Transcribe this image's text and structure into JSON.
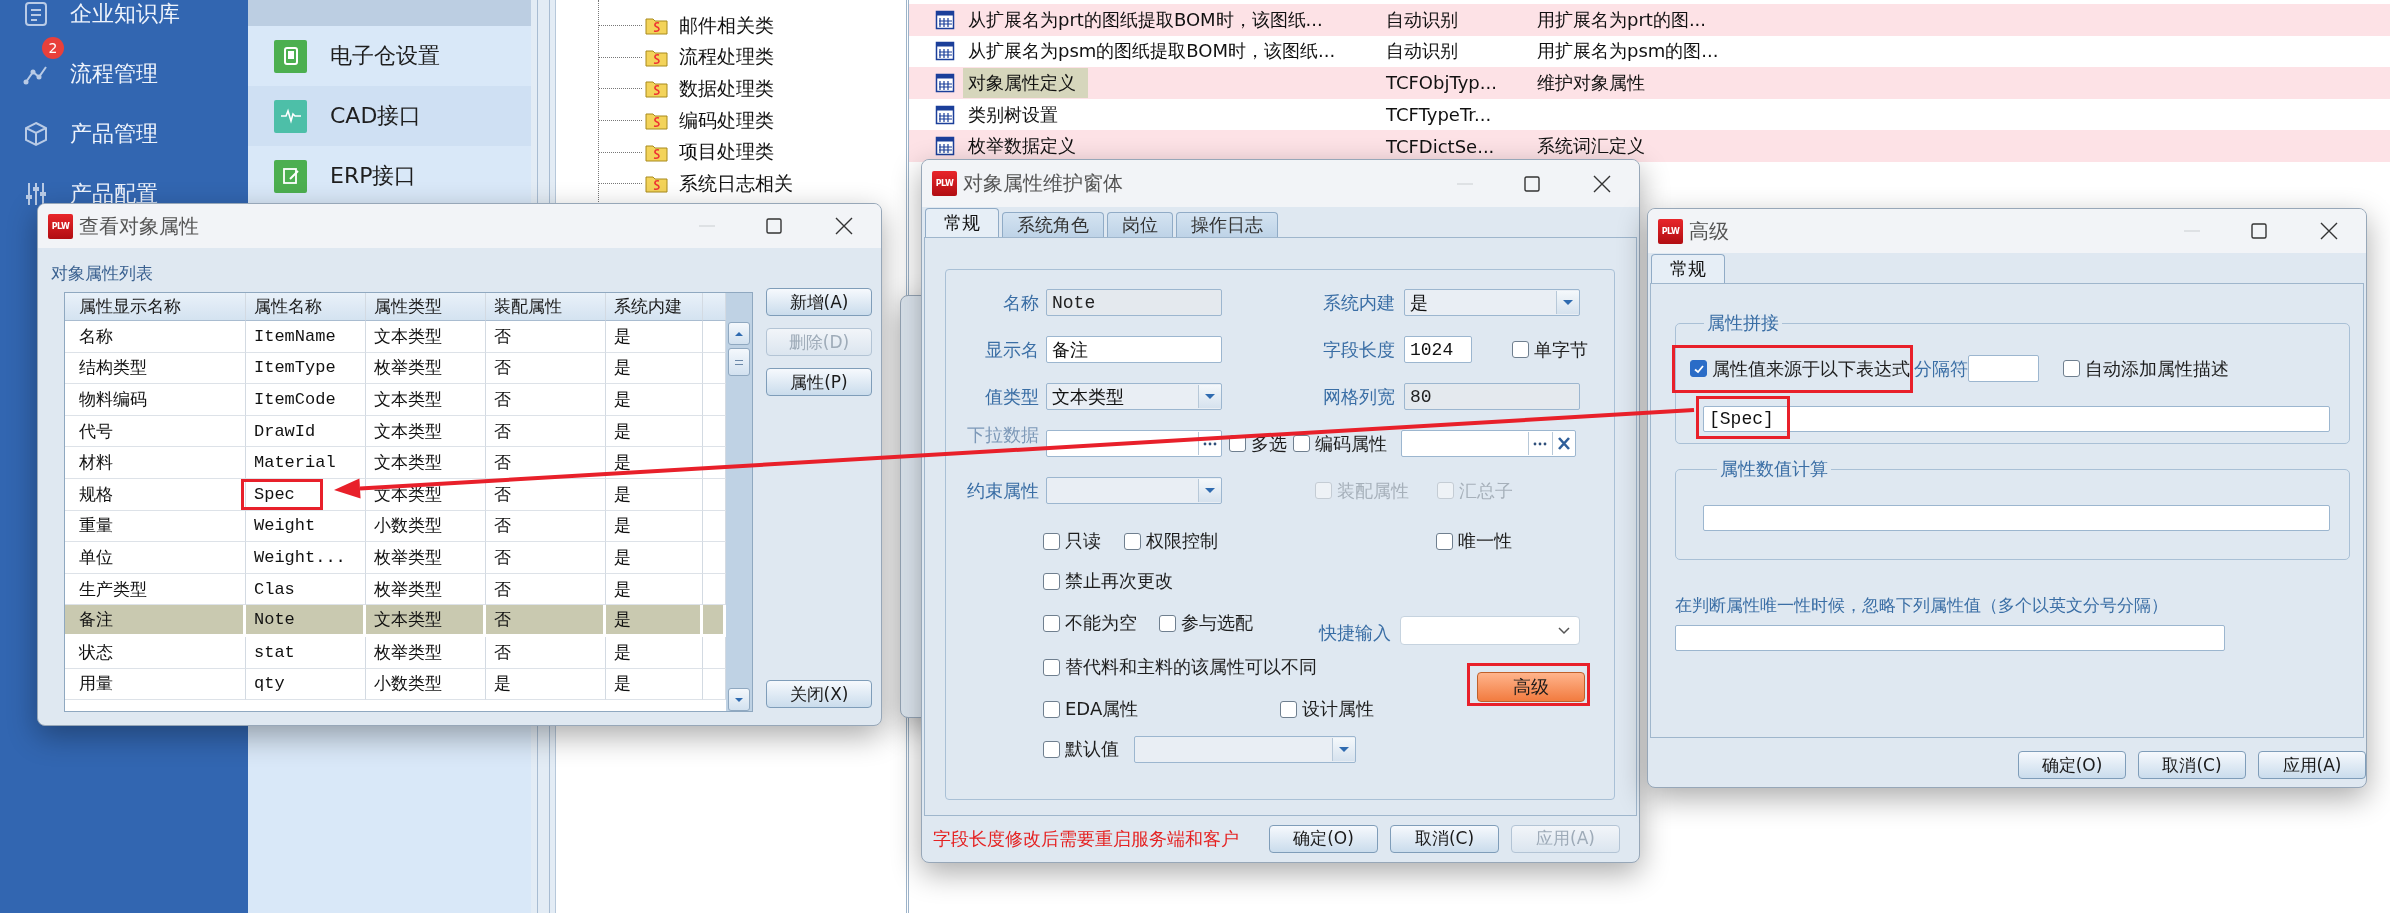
{
  "sidebar": {
    "items": [
      {
        "label": "企业知识库"
      },
      {
        "label": "流程管理",
        "badge": "2"
      },
      {
        "label": "产品管理"
      },
      {
        "label": "产品配置"
      }
    ]
  },
  "submenu": {
    "items": [
      {
        "label": "电子仓设置",
        "color": "#4caf50"
      },
      {
        "label": "CAD接口",
        "color": "#4dbfa8"
      },
      {
        "label": "ERP接口",
        "color": "#4caf50"
      }
    ]
  },
  "tree": {
    "items": [
      "邮件相关类",
      "流程处理类",
      "数据处理类",
      "编码处理类",
      "项目处理类",
      "系统日志相关"
    ]
  },
  "function_list": {
    "rows": [
      {
        "name": "从扩展名为prt的图纸提取BOM时，该图纸...",
        "code": "自动识别",
        "description": "用扩展名为prt的图...",
        "selected": false
      },
      {
        "name": "从扩展名为psm的图纸提取BOM时，该图纸...",
        "code": "自动识别",
        "description": "用扩展名为psm的图...",
        "selected": false
      },
      {
        "name": "对象属性定义",
        "code": "TCFObjTyp...",
        "description": "维护对象属性",
        "selected": true
      },
      {
        "name": "类别树设置",
        "code": "TCFTypeTr...",
        "selected": false
      },
      {
        "name": "枚举数据定义",
        "code": "TCFDictSe...",
        "description": "系统词汇定义",
        "selected": false
      }
    ]
  },
  "attribute_viewer": {
    "app_icon": "PLW",
    "title": "查看对象属性",
    "section_label": "对象属性列表",
    "columns": [
      {
        "label": "属性显示名称",
        "kind": "text"
      },
      {
        "label": "属性名称",
        "kind": "key"
      },
      {
        "label": "属性类型",
        "kind": "text"
      },
      {
        "label": "装配属性",
        "kind": "text"
      },
      {
        "label": "系统内建",
        "kind": "text"
      }
    ],
    "rows": [
      {
        "cells": [
          "名称",
          "ItemName",
          "文本类型",
          "否",
          "是"
        ],
        "selected": false,
        "framed": false
      },
      {
        "cells": [
          "结构类型",
          "ItemType",
          "枚举类型",
          "否",
          "是"
        ],
        "selected": false,
        "framed": false
      },
      {
        "cells": [
          "物料编码",
          "ItemCode",
          "文本类型",
          "否",
          "是"
        ],
        "selected": false,
        "framed": false
      },
      {
        "cells": [
          "代号",
          "DrawId",
          "文本类型",
          "否",
          "是"
        ],
        "selected": false,
        "framed": false
      },
      {
        "cells": [
          "材料",
          "Material",
          "文本类型",
          "否",
          "是"
        ],
        "selected": false,
        "framed": false
      },
      {
        "cells": [
          "规格",
          "Spec",
          "文本类型",
          "否",
          "是"
        ],
        "selected": false,
        "framed": true
      },
      {
        "cells": [
          "重量",
          "Weight",
          "小数类型",
          "否",
          "是"
        ],
        "selected": false,
        "framed": false
      },
      {
        "cells": [
          "单位",
          "Weight...",
          "枚举类型",
          "否",
          "是"
        ],
        "selected": false,
        "framed": false
      },
      {
        "cells": [
          "生产类型",
          "Clas",
          "枚举类型",
          "否",
          "是"
        ],
        "selected": false,
        "framed": false
      },
      {
        "cells": [
          "备注",
          "Note",
          "文本类型",
          "否",
          "是"
        ],
        "selected": true,
        "framed": false
      },
      {
        "cells": [
          "状态",
          "stat",
          "枚举类型",
          "否",
          "是"
        ],
        "selected": false,
        "framed": false
      },
      {
        "cells": [
          "用量",
          "qty",
          "小数类型",
          "是",
          "是"
        ],
        "selected": false,
        "framed": false
      }
    ],
    "buttons": [
      {
        "label": "新增(A)",
        "disabled": false
      },
      {
        "label": "删除(D)",
        "disabled": true
      },
      {
        "label": "属性(P)",
        "disabled": false
      }
    ],
    "close_button": {
      "label": "关闭(X)"
    }
  },
  "attribute_editor": {
    "app_icon": "PLW",
    "title": "对象属性维护窗体",
    "tabs": [
      {
        "label": "常规",
        "selected": true
      },
      {
        "label": "系统角色",
        "selected": false
      },
      {
        "label": "岗位",
        "selected": false
      },
      {
        "label": "操作日志",
        "selected": false
      }
    ],
    "name": {
      "label": "名称",
      "value": "Note",
      "disabled": true
    },
    "builtin": {
      "label": "系统内建",
      "value": "是"
    },
    "display_name": {
      "label": "显示名",
      "value": "备注",
      "disabled": false
    },
    "field_length": {
      "label": "字段长度",
      "value": "1024",
      "disabled": false
    },
    "single_byte": {
      "label": "单字节",
      "checked": false
    },
    "value_type": {
      "label": "值类型",
      "value": "文本类型"
    },
    "grid_width": {
      "label": "网格列宽",
      "value": "80",
      "disabled": true
    },
    "dropdown_data": {
      "label": "下拉数据"
    },
    "multi_select": {
      "label": "多选",
      "checked": false
    },
    "code_attribute": {
      "label": "编码属性",
      "checked": false
    },
    "constraint": {
      "label": "约束属性"
    },
    "assembly_attribute": {
      "label": "装配属性",
      "checked": false,
      "disabled": true
    },
    "summary": {
      "label": "汇总子",
      "checked": false,
      "disabled": true
    },
    "readonly": {
      "label": "只读",
      "checked": false
    },
    "permission": {
      "label": "权限控制",
      "checked": false
    },
    "unique": {
      "label": "唯一性",
      "checked": false
    },
    "no_change": {
      "label": "禁止再次更改",
      "checked": false
    },
    "not_null": {
      "label": "不能为空",
      "checked": false
    },
    "option_config": {
      "label": "参与选配",
      "checked": false
    },
    "quick_input": {
      "label": "快捷输入"
    },
    "substitute": {
      "label": "替代料和主料的该属性可以不同",
      "checked": false
    },
    "advanced_button": {
      "label": "高级",
      "kind": "accent",
      "framed": true
    },
    "eda": {
      "label": "EDA属性",
      "checked": false
    },
    "design": {
      "label": "设计属性",
      "checked": false
    },
    "default_value": {
      "label": "默认值",
      "checked": false
    },
    "note": "字段长度修改后需要重启服务端和客户",
    "buttons": [
      {
        "label": "确定(O)",
        "disabled": false
      },
      {
        "label": "取消(C)",
        "disabled": false
      },
      {
        "label": "应用(A)",
        "disabled": true
      }
    ]
  },
  "advanced_dialog": {
    "app_icon": "PLW",
    "title": "高级",
    "tabs": [
      {
        "label": "常规",
        "selected": true
      }
    ],
    "concat_group": {
      "legend": "属性拼接",
      "use_expression": {
        "label": "属性值来源于以下表达式",
        "checked": true,
        "framed": true
      },
      "separator": {
        "label": "分隔符"
      },
      "auto_describe": {
        "label": "自动添加属性描述",
        "checked": false
      },
      "expression": {
        "value": "[Spec]",
        "framed": true
      }
    },
    "calc_group": {
      "legend": "属性数值计算"
    },
    "ignore_label": "在判断属性唯一性时候，忽略下列属性值（多个以英文分号分隔）",
    "buttons": [
      {
        "label": "确定(O)",
        "disabled": false
      },
      {
        "label": "取消(C)",
        "disabled": false
      },
      {
        "label": "应用(A)",
        "disabled": false
      }
    ]
  }
}
